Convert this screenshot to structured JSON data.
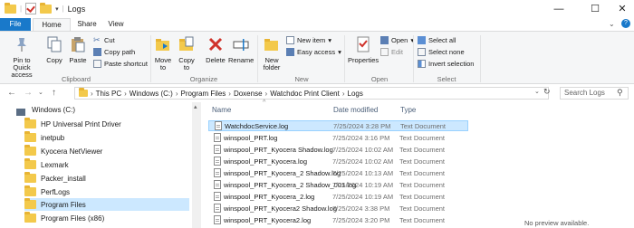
{
  "window": {
    "title": "Logs",
    "controls": [
      "—",
      "☐",
      "✕"
    ]
  },
  "tabs": [
    "File",
    "Home",
    "Share",
    "View"
  ],
  "ribbon": {
    "clipboard": {
      "pin": "Pin to Quick access",
      "copy": "Copy",
      "paste": "Paste",
      "cut": "Cut",
      "copy_path": "Copy path",
      "paste_shortcut": "Paste shortcut",
      "label": "Clipboard"
    },
    "organize": {
      "move_to": "Move to",
      "copy_to": "Copy to",
      "delete": "Delete",
      "rename": "Rename",
      "label": "Organize"
    },
    "new": {
      "new_folder": "New folder",
      "new_item": "New item",
      "easy_access": "Easy access",
      "label": "New"
    },
    "open": {
      "properties": "Properties",
      "open": "Open",
      "edit": "Edit",
      "label": "Open"
    },
    "select": {
      "select_all": "Select all",
      "select_none": "Select none",
      "invert": "Invert selection",
      "label": "Select"
    }
  },
  "address": {
    "breadcrumbs": [
      "This PC",
      "Windows (C:)",
      "Program Files",
      "Doxense",
      "Watchdoc Print Client",
      "Logs"
    ],
    "search_placeholder": "Search Logs"
  },
  "nav_pane": {
    "items": [
      {
        "label": "Windows (C:)",
        "selected": false
      },
      {
        "label": "HP Universal Print Driver",
        "selected": false
      },
      {
        "label": "inetpub",
        "selected": false
      },
      {
        "label": "Kyocera NetViewer",
        "selected": false
      },
      {
        "label": "Lexmark",
        "selected": false
      },
      {
        "label": "Packer_install",
        "selected": false
      },
      {
        "label": "PerfLogs",
        "selected": false
      },
      {
        "label": "Program Files",
        "selected": true
      },
      {
        "label": "Program Files (x86)",
        "selected": false
      }
    ]
  },
  "file_list": {
    "columns": [
      "Name",
      "Date modified",
      "Type"
    ],
    "rows": [
      {
        "name": "WatchdocService.log",
        "date": "7/25/2024 3:28 PM",
        "type": "Text Document",
        "selected": true
      },
      {
        "name": "winspool_PRT.log",
        "date": "7/25/2024 3:16 PM",
        "type": "Text Document",
        "selected": false
      },
      {
        "name": "winspool_PRT_Kyocera Shadow.log",
        "date": "7/25/2024 10:02 AM",
        "type": "Text Document",
        "selected": false
      },
      {
        "name": "winspool_PRT_Kyocera.log",
        "date": "7/25/2024 10:02 AM",
        "type": "Text Document",
        "selected": false
      },
      {
        "name": "winspool_PRT_Kyocera_2 Shadow.log",
        "date": "7/25/2024 10:13 AM",
        "type": "Text Document",
        "selected": false
      },
      {
        "name": "winspool_PRT_Kyocera_2 Shadow_001.log",
        "date": "7/25/2024 10:19 AM",
        "type": "Text Document",
        "selected": false
      },
      {
        "name": "winspool_PRT_Kyocera_2.log",
        "date": "7/25/2024 10:19 AM",
        "type": "Text Document",
        "selected": false
      },
      {
        "name": "winspool_PRT_Kyocera2 Shadow.log",
        "date": "7/25/2024 3:38 PM",
        "type": "Text Document",
        "selected": false
      },
      {
        "name": "winspool_PRT_Kyocera2.log",
        "date": "7/25/2024 3:20 PM",
        "type": "Text Document",
        "selected": false
      }
    ]
  },
  "preview": "No preview available.",
  "colors": {
    "accent": "#1979ca",
    "selection": "#cce8ff",
    "folder": "#f3c94b"
  }
}
